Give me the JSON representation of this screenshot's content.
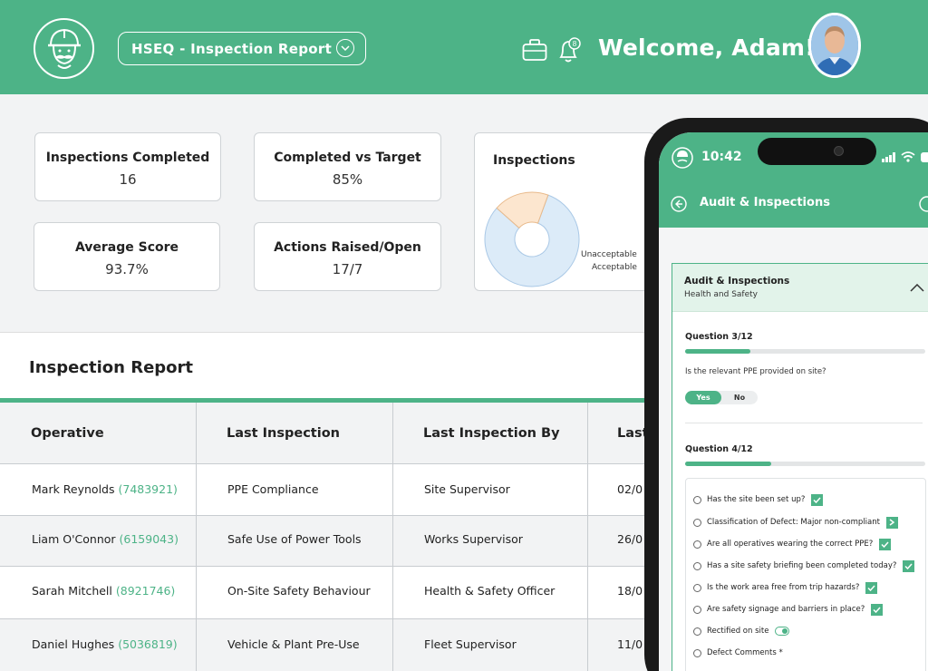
{
  "header": {
    "report_selector": "HSEQ - Inspection Report",
    "welcome": "Welcome, Adam!",
    "notification_count": "8"
  },
  "kpis": [
    {
      "label": "Inspections Completed",
      "value": "16"
    },
    {
      "label": "Completed vs Target",
      "value": "85%"
    },
    {
      "label": "Average Score",
      "value": "93.7%"
    },
    {
      "label": "Actions Raised/Open",
      "value": "17/7"
    }
  ],
  "chart_data": {
    "type": "pie",
    "title": "Inspections",
    "slices": [
      {
        "label": "Acceptable",
        "value": 81,
        "color": "#dcebf8"
      },
      {
        "label": "Unacceptable",
        "value": 19,
        "color": "#fce6cf"
      }
    ]
  },
  "report": {
    "title": "Inspection Report",
    "columns": [
      "Operative",
      "Last Inspection",
      "Last Inspection By",
      "Last"
    ],
    "rows": [
      {
        "operative": "Mark Reynolds",
        "code": "(7483921)",
        "inspection": "PPE Compliance",
        "by": "Site Supervisor",
        "date": "02/0"
      },
      {
        "operative": "Liam O'Connor",
        "code": "(6159043)",
        "inspection": "Safe Use of Power Tools",
        "by": "Works Supervisor",
        "date": "26/0"
      },
      {
        "operative": "Sarah Mitchell",
        "code": "(8921746)",
        "inspection": "On-Site Safety Behaviour",
        "by": "Health & Safety Officer",
        "date": "18/0"
      },
      {
        "operative": "Daniel Hughes",
        "code": "(5036819)",
        "inspection": "Vehicle & Plant Pre-Use",
        "by": "Fleet Supervisor",
        "date": "11/0"
      }
    ]
  },
  "phone": {
    "time": "10:42",
    "app_title": "Audit & Inspections",
    "card_title": "Audit & Inspections",
    "card_subtitle": "Health and Safety",
    "q3_label": "Question 3/12",
    "q3_progress": 0.27,
    "q3_text": "Is the relevant PPE provided on site?",
    "yes": "Yes",
    "no": "No",
    "q4_label": "Question 4/12",
    "q4_progress": 0.36,
    "checklist": [
      {
        "text": "Has the site been set up?",
        "control": "check"
      },
      {
        "text": "Classification of Defect: Major non-compliant",
        "control": "arrow"
      },
      {
        "text": "Are all operatives wearing the correct PPE?",
        "control": "check"
      },
      {
        "text": "Has a site safety briefing been completed today?",
        "control": "check"
      },
      {
        "text": "Is the work area free from trip hazards?",
        "control": "check"
      },
      {
        "text": "Are safety signage and barriers in place?",
        "control": "check"
      },
      {
        "text": "Rectified on site",
        "control": "toggle"
      },
      {
        "text": "Defect Comments *",
        "control": "none"
      }
    ]
  }
}
